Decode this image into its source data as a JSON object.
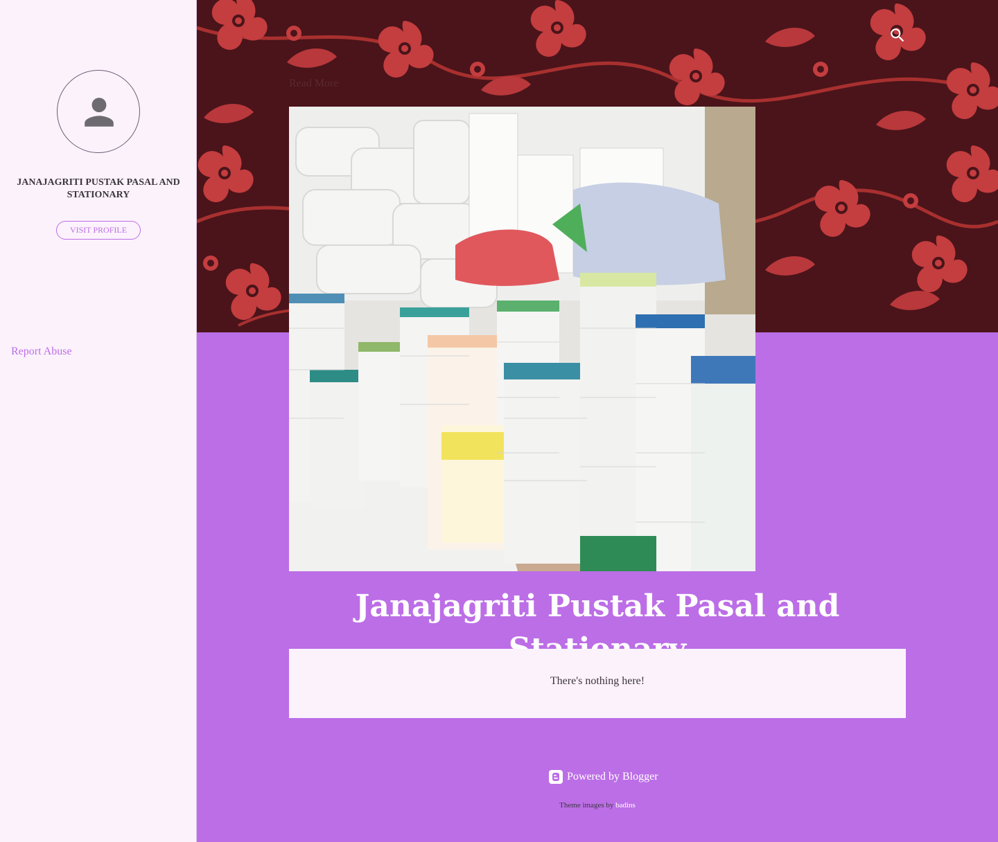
{
  "sidebar": {
    "profile_name": "JANAJAGRITI PUSTAK PASAL AND STATIONARY",
    "visit_profile": "VISIT PROFILE",
    "report_abuse": "Report Abuse"
  },
  "header": {
    "read_more": "Read More"
  },
  "blog": {
    "title": "Janajagriti Pustak Pasal and Stationary",
    "empty_message": "There's nothing here!"
  },
  "footer": {
    "powered_by": "Powered by Blogger",
    "theme_images_prefix": "Theme images by",
    "theme_images_author": "badins"
  },
  "colors": {
    "accent": "#bc6ee6",
    "header_bg": "#4a141a",
    "sidebar_bg": "#fcf2fc",
    "floral": "#c43d3f"
  },
  "icons": {
    "search": "search-icon",
    "avatar": "person-icon",
    "blogger": "blogger-icon"
  }
}
